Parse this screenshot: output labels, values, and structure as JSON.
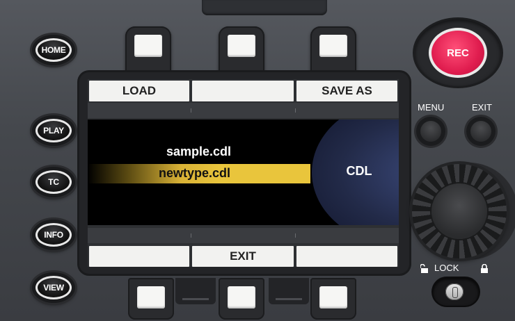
{
  "left_buttons": [
    "HOME",
    "PLAY",
    "TC",
    "INFO",
    "VIEW"
  ],
  "softkeys_top": [
    "LOAD",
    "",
    "SAVE AS"
  ],
  "softkeys_bottom": [
    "",
    "EXIT",
    ""
  ],
  "files": [
    "sample.cdl",
    "newtype.cdl"
  ],
  "selected_file": "newtype.cdl",
  "panel_label": "CDL",
  "rec_label": "REC",
  "menu_label": "MENU",
  "exit_label": "EXIT",
  "lock_label": "LOCK",
  "colors": {
    "highlight": "#e9c53c",
    "rec": "#e01d4f"
  },
  "icons": [
    "unlock-icon",
    "lock-icon"
  ]
}
